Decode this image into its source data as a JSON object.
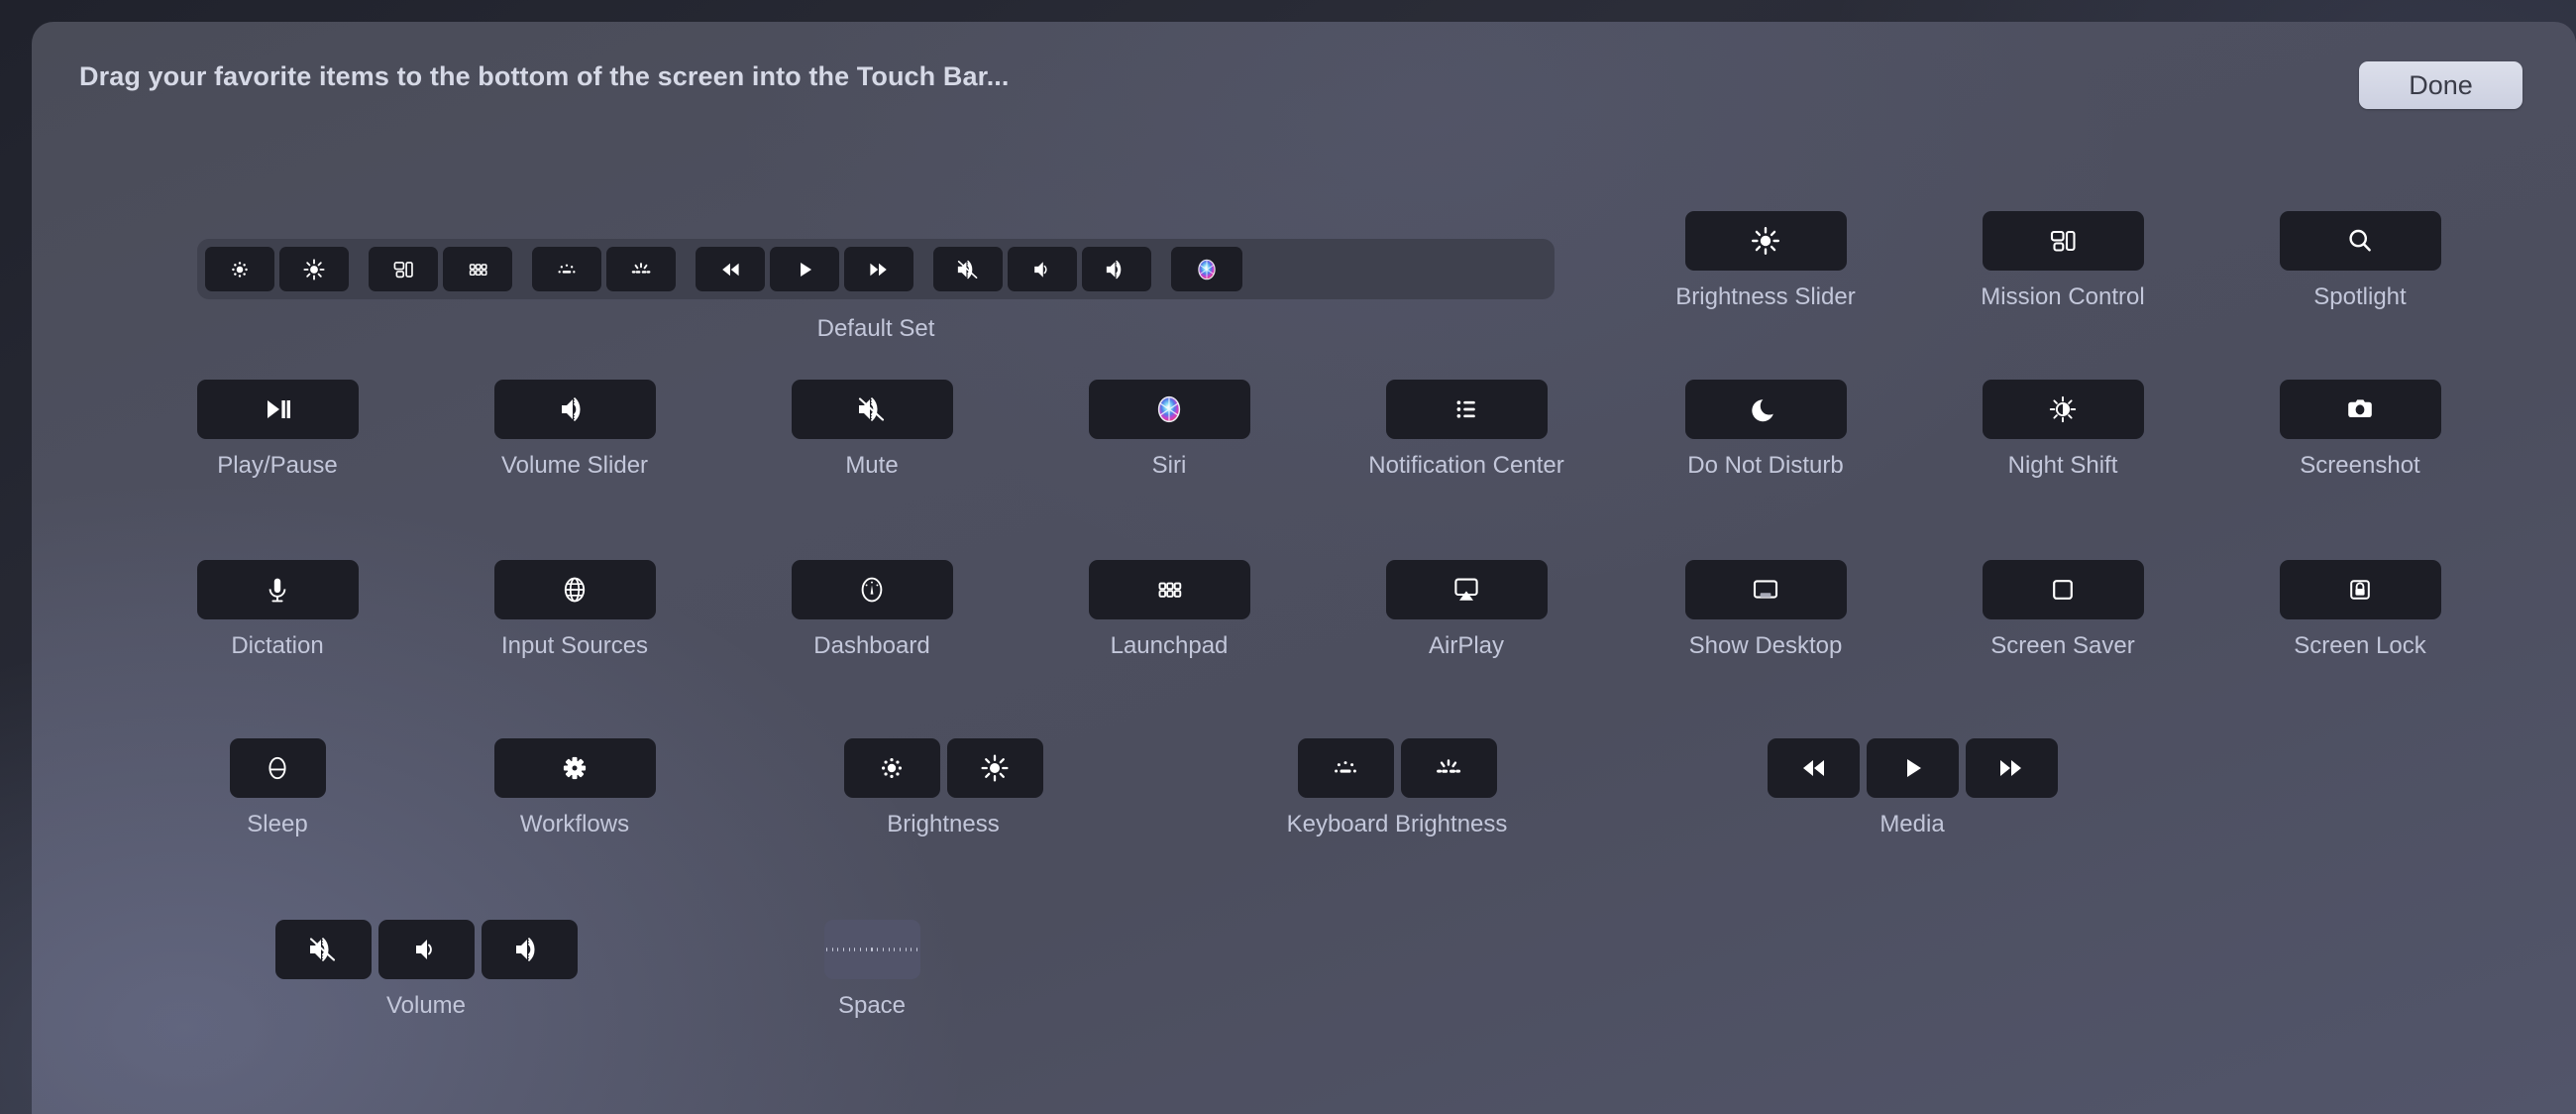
{
  "header": {
    "title": "Drag your favorite items to the bottom of the screen into the Touch Bar...",
    "done_label": "Done"
  },
  "default_set": {
    "label": "Default Set",
    "keys": [
      {
        "icon": "brightness-down-icon"
      },
      {
        "icon": "brightness-up-icon"
      },
      {
        "icon": "mission-control-icon"
      },
      {
        "icon": "launchpad-icon"
      },
      {
        "icon": "keyboard-brightness-down-icon"
      },
      {
        "icon": "keyboard-brightness-up-icon"
      },
      {
        "icon": "rewind-icon"
      },
      {
        "icon": "play-icon"
      },
      {
        "icon": "fast-forward-icon"
      },
      {
        "icon": "mute-icon"
      },
      {
        "icon": "volume-down-icon"
      },
      {
        "icon": "volume-up-icon"
      },
      {
        "icon": "siri-icon"
      }
    ]
  },
  "items": [
    {
      "label": "Brightness Slider",
      "icons": [
        "brightness-slider-icon"
      ],
      "width": "wide"
    },
    {
      "label": "Mission Control",
      "icons": [
        "mission-control-icon"
      ],
      "width": "wide"
    },
    {
      "label": "Spotlight",
      "icons": [
        "spotlight-icon"
      ],
      "width": "wide"
    },
    {
      "label": "Play/Pause",
      "icons": [
        "play-pause-icon"
      ],
      "width": "wide"
    },
    {
      "label": "Volume Slider",
      "icons": [
        "volume-up-icon"
      ],
      "width": "wide"
    },
    {
      "label": "Mute",
      "icons": [
        "mute-icon"
      ],
      "width": "wide"
    },
    {
      "label": "Siri",
      "icons": [
        "siri-icon"
      ],
      "width": "wide"
    },
    {
      "label": "Notification Center",
      "icons": [
        "notification-center-icon"
      ],
      "width": "wide"
    },
    {
      "label": "Do Not Disturb",
      "icons": [
        "do-not-disturb-icon"
      ],
      "width": "wide"
    },
    {
      "label": "Night Shift",
      "icons": [
        "night-shift-icon"
      ],
      "width": "wide"
    },
    {
      "label": "Screenshot",
      "icons": [
        "screenshot-icon"
      ],
      "width": "wide"
    },
    {
      "label": "Dictation",
      "icons": [
        "dictation-icon"
      ],
      "width": "wide"
    },
    {
      "label": "Input Sources",
      "icons": [
        "input-sources-icon"
      ],
      "width": "wide"
    },
    {
      "label": "Dashboard",
      "icons": [
        "dashboard-icon"
      ],
      "width": "wide"
    },
    {
      "label": "Launchpad",
      "icons": [
        "launchpad-icon"
      ],
      "width": "wide"
    },
    {
      "label": "AirPlay",
      "icons": [
        "airplay-icon"
      ],
      "width": "wide"
    },
    {
      "label": "Show Desktop",
      "icons": [
        "show-desktop-icon"
      ],
      "width": "wide"
    },
    {
      "label": "Screen Saver",
      "icons": [
        "screen-saver-icon"
      ],
      "width": "wide"
    },
    {
      "label": "Screen Lock",
      "icons": [
        "screen-lock-icon"
      ],
      "width": "wide"
    },
    {
      "label": "Sleep",
      "icons": [
        "sleep-icon"
      ],
      "width": "single"
    },
    {
      "label": "Workflows",
      "icons": [
        "workflows-icon"
      ],
      "width": "wide"
    },
    {
      "label": "Brightness",
      "icons": [
        "brightness-down-icon",
        "brightness-up-icon"
      ],
      "width": "single"
    },
    {
      "label": "Keyboard Brightness",
      "icons": [
        "keyboard-brightness-down-icon",
        "keyboard-brightness-up-icon"
      ],
      "width": "single"
    },
    {
      "label": "Media",
      "icons": [
        "rewind-icon",
        "play-icon",
        "fast-forward-icon"
      ],
      "width": "media"
    },
    {
      "label": "Volume",
      "icons": [
        "mute-icon",
        "volume-down-icon",
        "volume-up-icon"
      ],
      "width": "single"
    },
    {
      "label": "Space",
      "icons": [
        "space-icon"
      ],
      "width": "space"
    }
  ],
  "colors": {
    "key_background": "#1c1d25",
    "panel_background": "#4e5060",
    "label_text": "#c3c7da",
    "done_background": "#d6d9e6",
    "space_key": "#52546a"
  }
}
